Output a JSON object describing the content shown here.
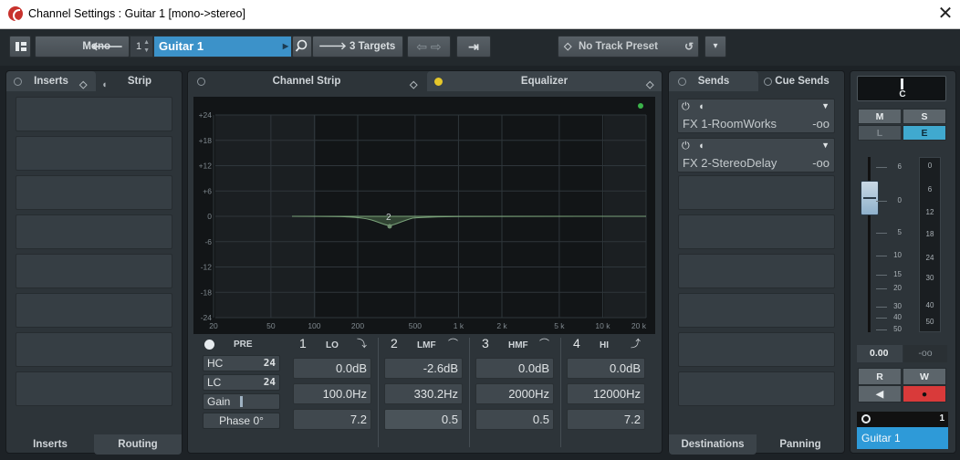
{
  "window": {
    "title": "Channel Settings : Guitar 1 [mono->stereo]",
    "close_glyph": "✕"
  },
  "toolbar": {
    "mode_label": "Mono",
    "mode_arrow": "🡐",
    "channel_number": "1",
    "track_name": "Guitar 1",
    "targets_label": "3 Targets",
    "targets_arrow": "🡒",
    "nav_glyphs": "⇦ ⇨",
    "routing_glyph": "⇥",
    "preset_label": "No Track Preset",
    "preset_menu_glyph": "▾"
  },
  "left_panel": {
    "tabs": [
      "Inserts",
      "Strip"
    ],
    "bottom_tabs": [
      "Inserts",
      "Routing"
    ]
  },
  "center_panel": {
    "tabs": [
      "Channel Strip",
      "Equalizer"
    ]
  },
  "right_panel": {
    "tabs": [
      "Sends",
      "Cue Sends"
    ],
    "sends": [
      {
        "name": "FX 1-RoomWorks",
        "level": "-oo"
      },
      {
        "name": "FX 2-StereoDelay",
        "level": "-oo"
      }
    ],
    "bottom_tabs": [
      "Destinations",
      "Panning"
    ]
  },
  "eq": {
    "y_ticks": [
      "+24",
      "+18",
      "+12",
      "+6",
      "0",
      "-6",
      "-12",
      "-18",
      "-24"
    ],
    "x_ticks": [
      "20",
      "50",
      "100",
      "200",
      "500",
      "1 k",
      "2 k",
      "5 k",
      "10 k",
      "20 k"
    ],
    "node_label": "2",
    "pre_label": "PRE",
    "hc_label": "HC",
    "hc_value": "24",
    "lc_label": "LC",
    "lc_value": "24",
    "gain_label": "Gain",
    "phase_label": "Phase 0°",
    "bands": [
      {
        "num": "1",
        "name": "LO",
        "gain": "0.0dB",
        "freq": "100.0Hz",
        "q": "7.2"
      },
      {
        "num": "2",
        "name": "LMF",
        "gain": "-2.6dB",
        "freq": "330.2Hz",
        "q": "0.5"
      },
      {
        "num": "3",
        "name": "HMF",
        "gain": "0.0dB",
        "freq": "2000Hz",
        "q": "0.5"
      },
      {
        "num": "4",
        "name": "HI",
        "gain": "0.0dB",
        "freq": "12000Hz",
        "q": "7.2"
      }
    ]
  },
  "fader": {
    "pan_value": "C",
    "buttons": [
      "M",
      "S",
      "L",
      "E"
    ],
    "fader_scale": [
      "6",
      "0",
      "5",
      "10",
      "15",
      "20",
      "30",
      "40",
      "50"
    ],
    "meter_scale": [
      "0",
      "6",
      "12",
      "18",
      "24",
      "30",
      "40",
      "50"
    ],
    "volume": "0.00",
    "peak": "-oo",
    "rw": [
      "R",
      "W"
    ],
    "channel_number": "1",
    "channel_name": "Guitar 1",
    "accent": "#2e9ad8"
  }
}
